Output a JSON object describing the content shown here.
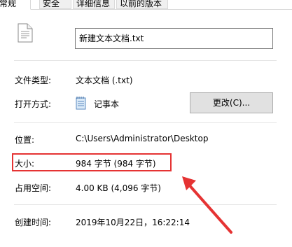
{
  "tabs": [
    "常规",
    "安全",
    "详细信息",
    "以前的版本"
  ],
  "file_name": "新建文本文档.txt",
  "fields": {
    "type_label": "文件类型:",
    "type_value": "文本文档 (.txt)",
    "open_label": "打开方式:",
    "open_value": "记事本",
    "change_button": "更改(C)...",
    "location_label": "位置:",
    "location_value": "C:\\Users\\Administrator\\Desktop",
    "size_label": "大小:",
    "size_value": "984 字节 (984 字节)",
    "disk_label": "占用空间:",
    "disk_value": "4.00 KB (4,096 字节)",
    "created_label": "创建时间:",
    "created_value": "2019年10月22日，16:22:14"
  },
  "colors": {
    "highlight": "#e53333",
    "arrow": "#e53333"
  },
  "icons": {
    "file": "text-file-icon",
    "app": "notepad-icon"
  }
}
